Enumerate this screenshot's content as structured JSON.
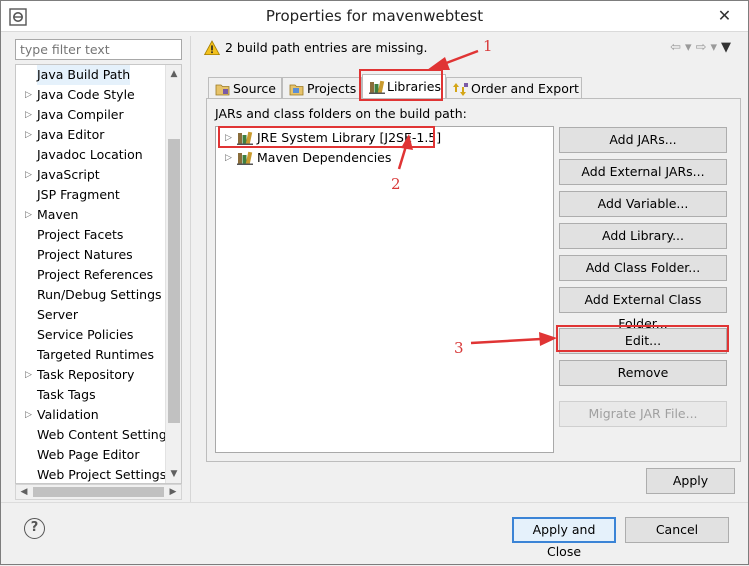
{
  "window": {
    "title": "Properties for mavenwebtest",
    "close_glyph": "✕"
  },
  "filter": {
    "placeholder": "type filter text"
  },
  "tree": {
    "items": [
      {
        "label": "Java Build Path",
        "expandable": false,
        "selected": true
      },
      {
        "label": "Java Code Style",
        "expandable": true
      },
      {
        "label": "Java Compiler",
        "expandable": true
      },
      {
        "label": "Java Editor",
        "expandable": true
      },
      {
        "label": "Javadoc Location",
        "expandable": false
      },
      {
        "label": "JavaScript",
        "expandable": true
      },
      {
        "label": "JSP Fragment",
        "expandable": false
      },
      {
        "label": "Maven",
        "expandable": true
      },
      {
        "label": "Project Facets",
        "expandable": false
      },
      {
        "label": "Project Natures",
        "expandable": false
      },
      {
        "label": "Project References",
        "expandable": false
      },
      {
        "label": "Run/Debug Settings",
        "expandable": false
      },
      {
        "label": "Server",
        "expandable": false
      },
      {
        "label": "Service Policies",
        "expandable": false
      },
      {
        "label": "Targeted Runtimes",
        "expandable": false
      },
      {
        "label": "Task Repository",
        "expandable": true
      },
      {
        "label": "Task Tags",
        "expandable": false
      },
      {
        "label": "Validation",
        "expandable": true
      },
      {
        "label": "Web Content Settings",
        "expandable": false
      },
      {
        "label": "Web Page Editor",
        "expandable": false
      },
      {
        "label": "Web Project Settings",
        "expandable": false
      }
    ]
  },
  "message": {
    "text": "2 build path entries are missing."
  },
  "tabs": [
    {
      "label": "Source",
      "icon": "source-folder-icon",
      "active": false
    },
    {
      "label": "Projects",
      "icon": "projects-icon",
      "active": false
    },
    {
      "label": "Libraries",
      "icon": "library-icon",
      "active": true
    },
    {
      "label": "Order and Export",
      "icon": "order-export-icon",
      "active": false
    }
  ],
  "panel": {
    "label": "JARs and class folders on the build path:",
    "libraries": [
      {
        "label": "JRE System Library [J2SE-1.5]",
        "icon": "library-icon"
      },
      {
        "label": "Maven Dependencies",
        "icon": "library-icon"
      }
    ],
    "buttons": [
      {
        "label": "Add JARs...",
        "enabled": true
      },
      {
        "label": "Add External JARs...",
        "enabled": true
      },
      {
        "label": "Add Variable...",
        "enabled": true
      },
      {
        "label": "Add Library...",
        "enabled": true
      },
      {
        "label": "Add Class Folder...",
        "enabled": true
      },
      {
        "label": "Add External Class Folder...",
        "enabled": true
      },
      {
        "label": "Edit...",
        "enabled": true
      },
      {
        "label": "Remove",
        "enabled": true
      },
      {
        "label": "Migrate JAR File...",
        "enabled": false
      }
    ]
  },
  "footer": {
    "apply": "Apply",
    "help": "?",
    "apply_close": "Apply and Close",
    "cancel": "Cancel"
  },
  "annotations": {
    "color": "#e03434",
    "labels": [
      "1",
      "2",
      "3"
    ]
  }
}
